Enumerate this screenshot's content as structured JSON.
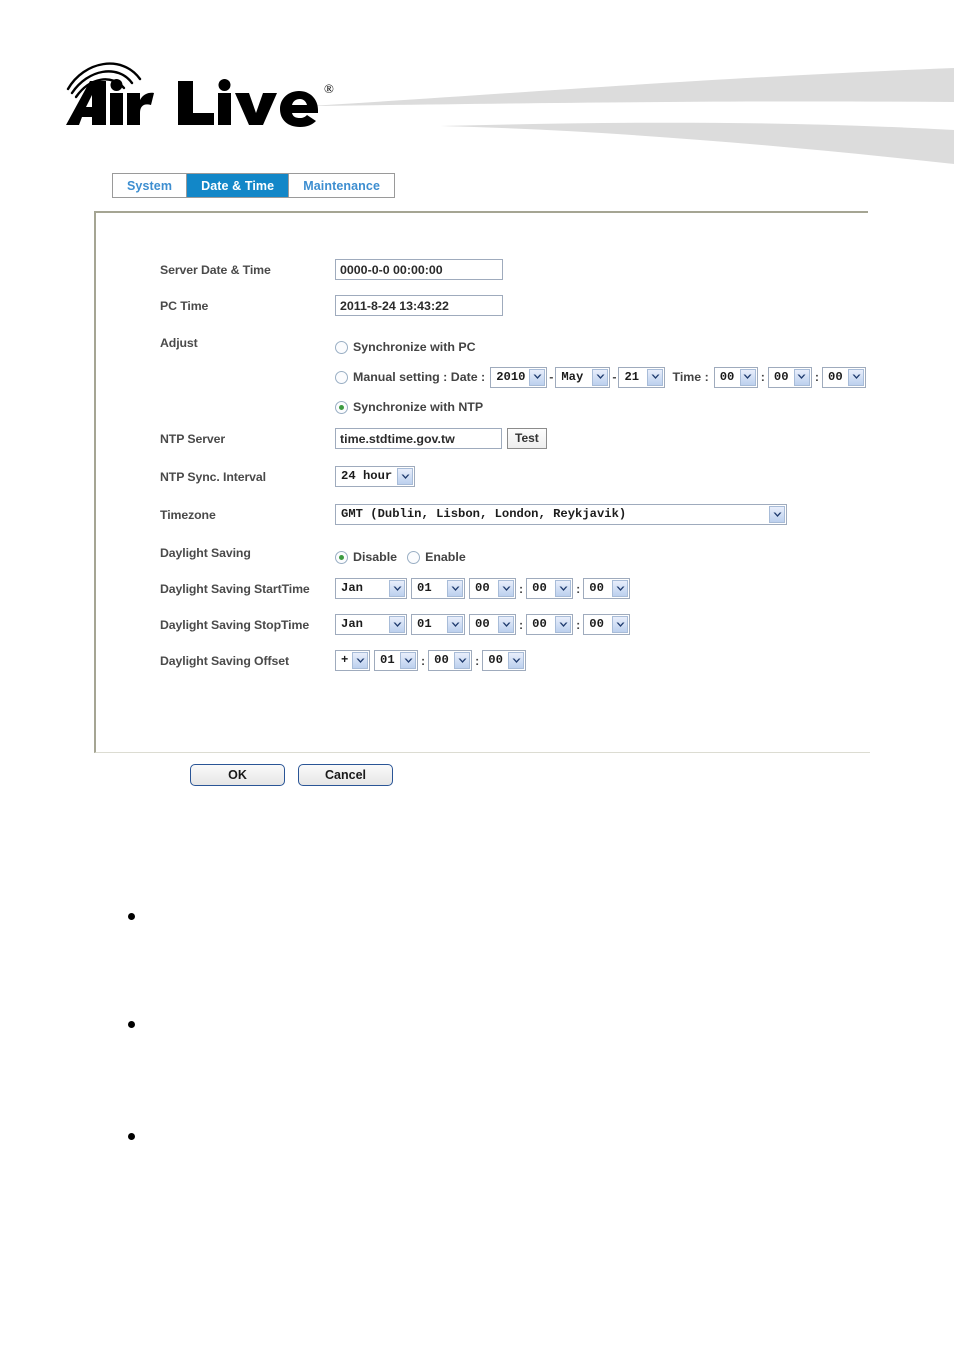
{
  "brand": {
    "name": "Air Live",
    "trademark": "®"
  },
  "tabs": [
    {
      "label": "System",
      "active": false
    },
    {
      "label": "Date & Time",
      "active": true
    },
    {
      "label": "Maintenance",
      "active": false
    }
  ],
  "form": {
    "server_date_time": {
      "label": "Server Date & Time",
      "value": "0000-0-0 00:00:00"
    },
    "pc_time": {
      "label": "PC Time",
      "value": "2011-8-24 13:43:22"
    },
    "adjust": {
      "label": "Adjust",
      "options": [
        {
          "label": "Synchronize with PC",
          "selected": false
        },
        {
          "label": "Manual setting : Date :",
          "selected": false
        },
        {
          "label": "Synchronize with NTP",
          "selected": true
        }
      ],
      "manual": {
        "year": "2010",
        "month": "May",
        "day": "21",
        "time_label": "Time :",
        "hour": "00",
        "minute": "00",
        "second": "00",
        "date_sep": "-",
        "time_sep": ":"
      }
    },
    "ntp_server": {
      "label": "NTP Server",
      "value": "time.stdtime.gov.tw",
      "test_label": "Test"
    },
    "ntp_sync_interval": {
      "label": "NTP Sync. Interval",
      "value": "24 hour"
    },
    "timezone": {
      "label": "Timezone",
      "value": "GMT (Dublin, Lisbon, London, Reykjavik)"
    },
    "daylight_saving": {
      "label": "Daylight Saving",
      "options": [
        {
          "label": "Disable",
          "selected": true
        },
        {
          "label": "Enable",
          "selected": false
        }
      ]
    },
    "dst_start": {
      "label": "Daylight Saving StartTime",
      "month": "Jan",
      "day": "01",
      "hour": "00",
      "minute": "00",
      "second": "00",
      "sep": ":"
    },
    "dst_stop": {
      "label": "Daylight Saving StopTime",
      "month": "Jan",
      "day": "01",
      "hour": "00",
      "minute": "00",
      "second": "00",
      "sep": ":"
    },
    "dst_offset": {
      "label": "Daylight Saving Offset",
      "sign": "+",
      "hour": "01",
      "minute": "00",
      "second": "00",
      "sep": ":"
    }
  },
  "footer": {
    "ok_label": "OK",
    "cancel_label": "Cancel"
  },
  "bullets": [
    {
      "text": ""
    },
    {
      "text": ""
    },
    {
      "text": ""
    }
  ],
  "colors": {
    "tab_active_bg": "#1287c8",
    "tab_text": "#3d8ed0",
    "radio_selected": "#3d9b41",
    "button_border": "#2a5596",
    "swoosh": "#dcdcdc"
  }
}
